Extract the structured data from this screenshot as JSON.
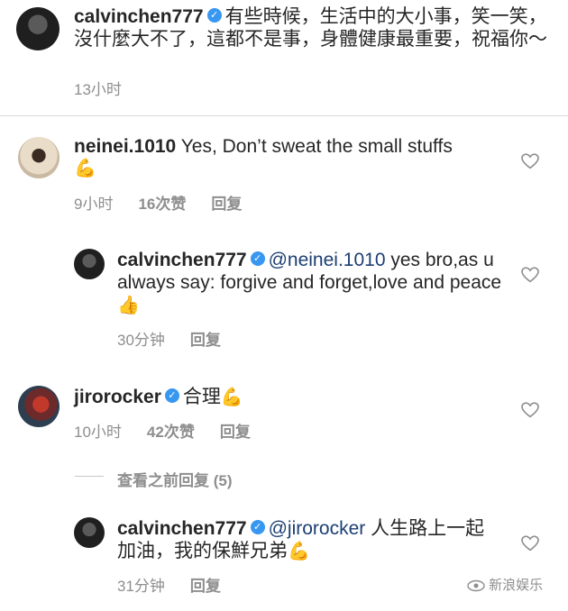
{
  "post": {
    "username": "calvinchen777",
    "text": "有些時候，生活中的大小事，笑一笑，沒什麼大不了，這都不是事，身體健康最重要，祝福你～",
    "time": "13小时"
  },
  "comments": [
    {
      "username": "neinei.1010",
      "text": "Yes, Don’t sweat the small stuffs",
      "emoji": "💪",
      "time": "9小时",
      "likes": "16次赞",
      "reply": "回复"
    },
    {
      "username": "calvinchen777",
      "mention": "@neinei.1010",
      "text": " yes bro,as u always say: forgive and forget,love and peace",
      "emoji": "👍",
      "time": "30分钟",
      "reply": "回复"
    },
    {
      "username": "jirorocker",
      "text": "合理",
      "emoji": "💪",
      "time": "10小时",
      "likes": "42次赞",
      "reply": "回复"
    },
    {
      "view_previous": "查看之前回复 (5)"
    },
    {
      "username": "calvinchen777",
      "mention": "@jirorocker",
      "text": " 人生路上一起加油，我的保鮮兄弟",
      "emoji": "💪",
      "time": "31分钟",
      "reply": "回复"
    }
  ],
  "watermark": "新浪娱乐",
  "icons": {
    "verified": "verified-badge-icon",
    "heart": "heart-outline-icon"
  }
}
